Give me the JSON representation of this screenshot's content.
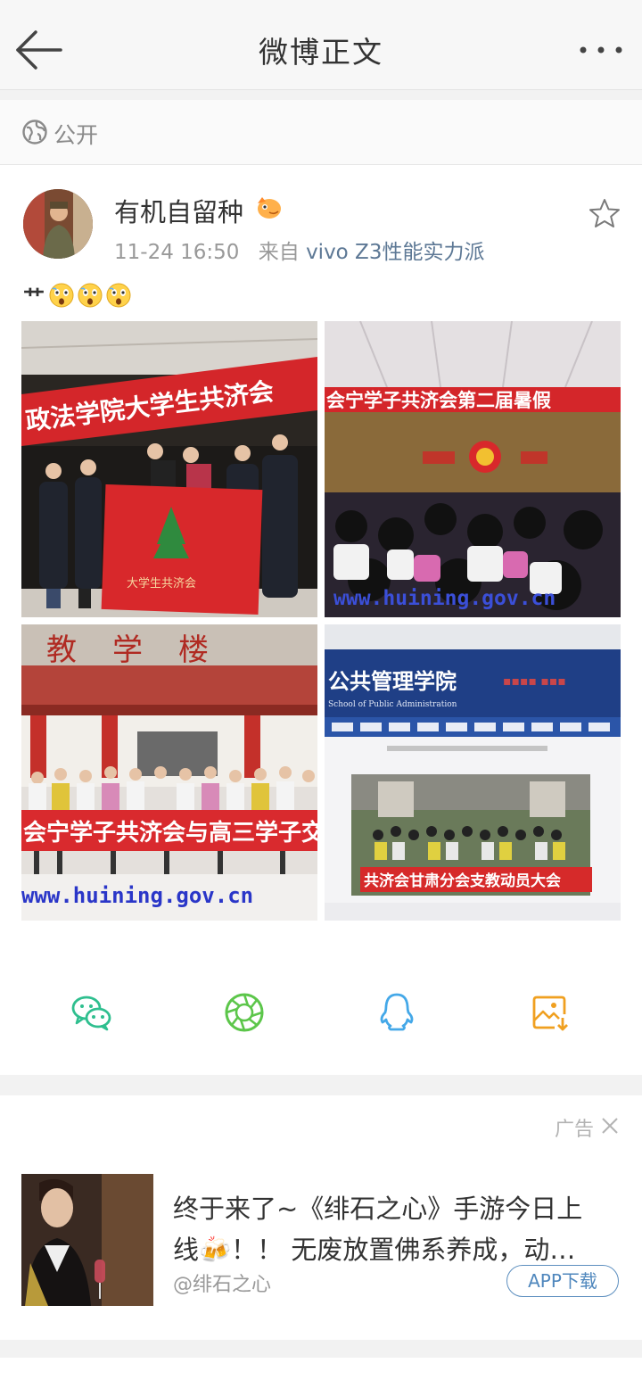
{
  "header": {
    "title": "微博正文"
  },
  "visibility": {
    "label": "公开"
  },
  "post": {
    "author": "有机自留种",
    "time": "11-24 16:50",
    "source_prefix": "来自",
    "source": "vivo Z3性能实力派",
    "text_mark": "艹",
    "photos": [
      {
        "banner": "政法学院大学生共济会",
        "flag_text": "大学生共济会"
      },
      {
        "banner": "会宁学子共济会第二届暑假",
        "watermark": "www.huining.gov.cn"
      },
      {
        "sign": "教学楼",
        "banner": "会宁学子共济会与高三学子交流",
        "watermark": "www.huining.gov.cn"
      },
      {
        "site_title": "公共管理学院",
        "site_subtitle": "School of Public Administration",
        "banner": "共济会甘肃分会支教动员大会"
      }
    ]
  },
  "share": {
    "icons": [
      "wechat-icon",
      "moments-icon",
      "qq-icon",
      "save-image-icon"
    ]
  },
  "ad": {
    "label": "广告",
    "text_line1": "终于来了~《绯石之心》手游今日上",
    "text_line2": "线🍻！！ 无废放置佛系养成，动…",
    "source": "@绯石之心",
    "button": "APP下载"
  },
  "colors": {
    "accent_blue": "#4f87bd",
    "share_green": "#2fbf8f",
    "share_orange": "#f0a020",
    "share_lightblue": "#44a8e8"
  }
}
